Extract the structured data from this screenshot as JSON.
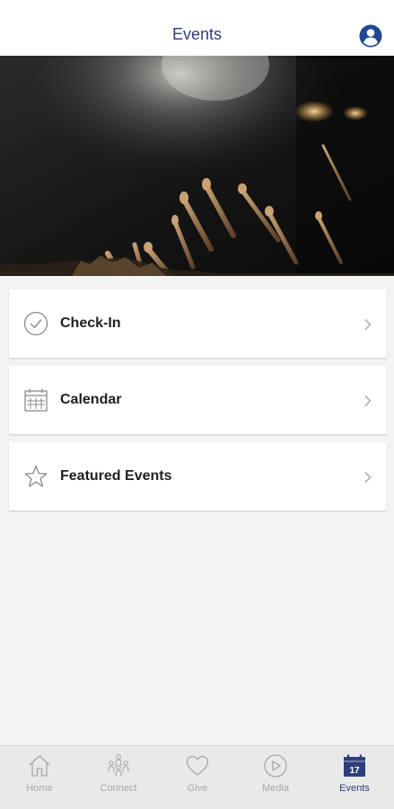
{
  "header": {
    "title": "Events",
    "account_icon": "account-circle-icon"
  },
  "hero": {
    "description_icon": "hero-image"
  },
  "menu": {
    "items": [
      {
        "label": "Check-In",
        "icon": "check-circle-icon"
      },
      {
        "label": "Calendar",
        "icon": "calendar-icon"
      },
      {
        "label": "Featured Events",
        "icon": "star-icon"
      }
    ]
  },
  "tabbar": {
    "active": "Events",
    "active_color": "#2e3f7c",
    "inactive_color": "#a7a7a7",
    "calendar_day": "17",
    "tabs": [
      {
        "label": "Home",
        "icon": "home-icon"
      },
      {
        "label": "Connect",
        "icon": "people-icon"
      },
      {
        "label": "Give",
        "icon": "heart-icon"
      },
      {
        "label": "Media",
        "icon": "play-circle-icon"
      },
      {
        "label": "Events",
        "icon": "calendar-icon"
      }
    ]
  }
}
